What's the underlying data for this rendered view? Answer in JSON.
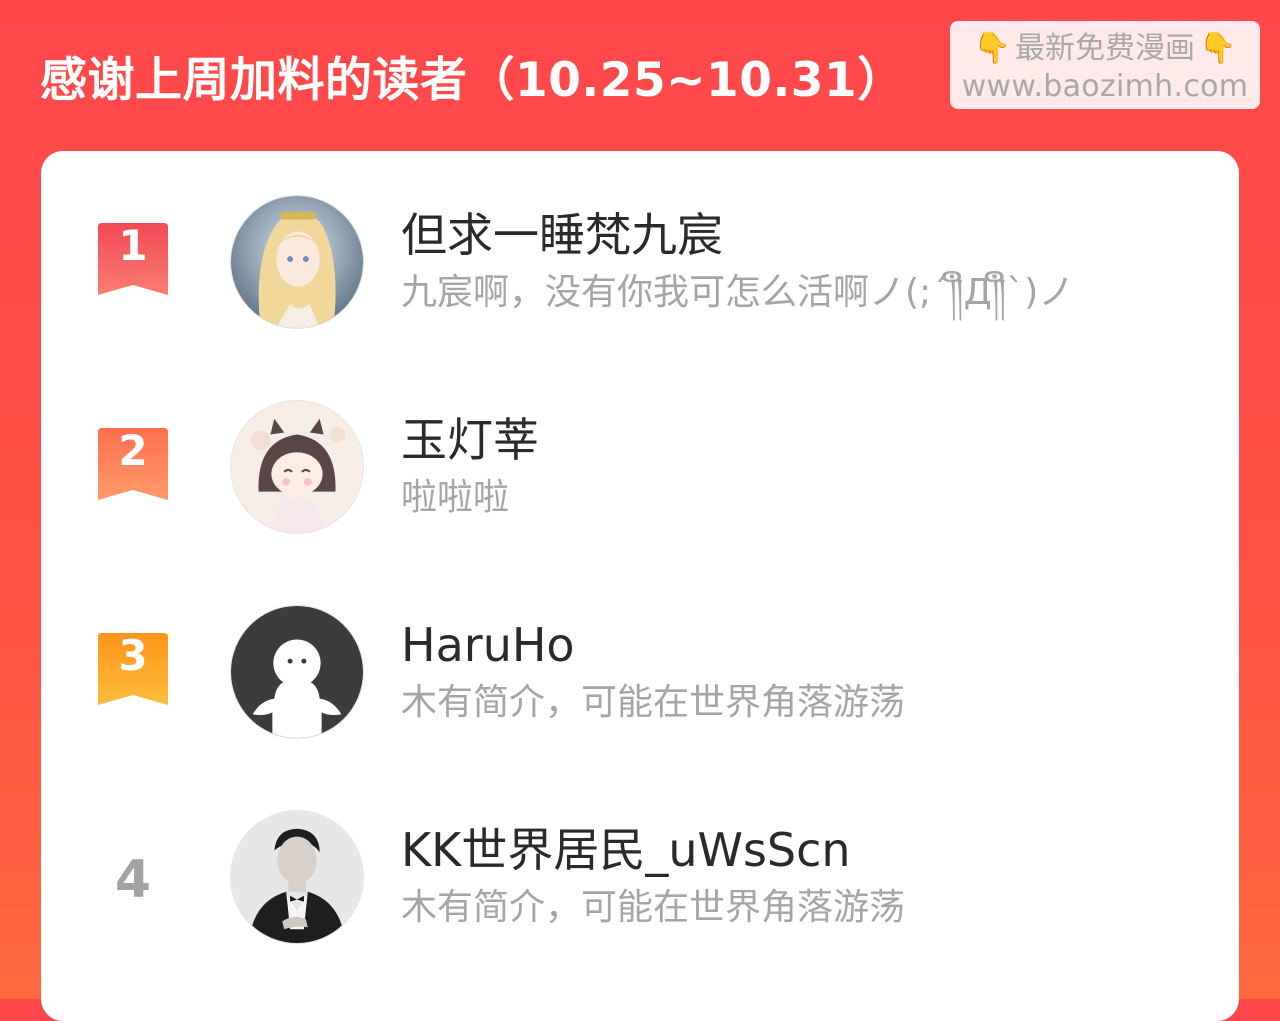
{
  "header": {
    "title": "感谢上周加料的读者（10.25~10.31）"
  },
  "watermark": {
    "hand_icon": "pointing-down-hand-icon",
    "line1": "最新免费漫画",
    "line2": "www.baozimh.com"
  },
  "colors": {
    "background": "#ff474b",
    "rank1": "#f75b5b",
    "rank2": "#ff7a52",
    "rank3": "#ffa21f",
    "rank_plain": "#a3a3a3"
  },
  "readers": [
    {
      "rank": "1",
      "name": "但求一睡梵九宸",
      "description": "九宸啊，没有你我可怎么活啊ノ(;´༎ຶД༎ຶ`)ノ",
      "avatar": "blonde-anime-character-avatar"
    },
    {
      "rank": "2",
      "name": "玉灯莘",
      "description": "啦啦啦",
      "avatar": "chibi-anime-girl-avatar"
    },
    {
      "rank": "3",
      "name": "HaruHo",
      "description": "木有简介，可能在世界角落游荡",
      "avatar": "default-ghost-avatar"
    },
    {
      "rank": "4",
      "name": "KK世界居民_uWsScn",
      "description": "木有简介，可能在世界角落游荡",
      "avatar": "tuxedo-man-photo-avatar"
    }
  ]
}
